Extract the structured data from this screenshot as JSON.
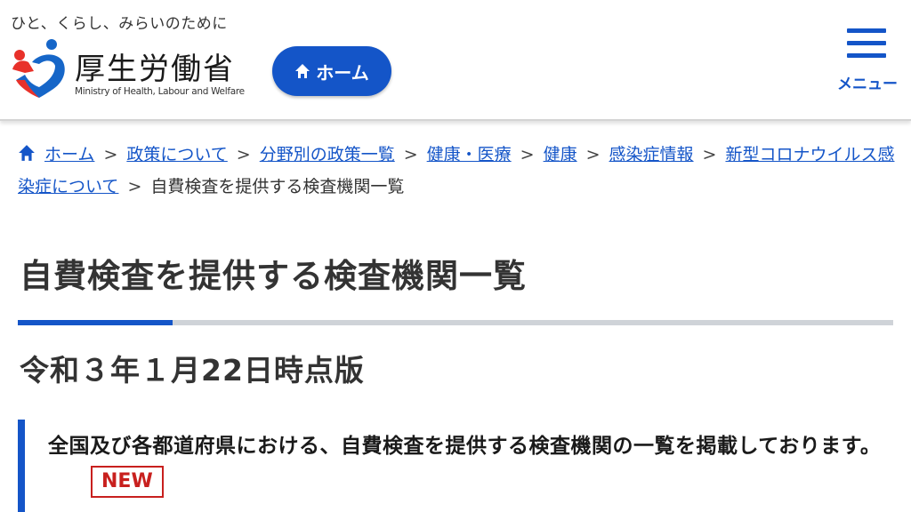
{
  "header": {
    "tagline": "ひと、くらし、みらいのために",
    "logo_jp": "厚生労働省",
    "logo_en": "Ministry of Health, Labour and Welfare",
    "home_label": "ホーム",
    "menu_label": "メニュー"
  },
  "breadcrumb": {
    "items": [
      {
        "label": "ホーム"
      },
      {
        "label": "政策について"
      },
      {
        "label": "分野別の政策一覧"
      },
      {
        "label": "健康・医療"
      },
      {
        "label": "健康"
      },
      {
        "label": "感染症情報"
      },
      {
        "label": "新型コロナウイルス感染症について"
      }
    ],
    "current": "自費検査を提供する検査機関一覧",
    "separator": ">"
  },
  "main": {
    "title": "自費検査を提供する検査機関一覧",
    "subtitle": "令和３年１月22日時点版",
    "notice": "全国及び各都道府県における、自費検査を提供する検査機関の一覧を掲載しております。",
    "badge": "NEW"
  },
  "colors": {
    "brand_blue": "#1455c8",
    "badge_red": "#c8201e",
    "logo_red": "#e8312a",
    "logo_blue": "#1666c8"
  },
  "icons": {
    "home": "home-icon",
    "menu": "hamburger-icon",
    "logo": "mhlw-logo-icon"
  }
}
